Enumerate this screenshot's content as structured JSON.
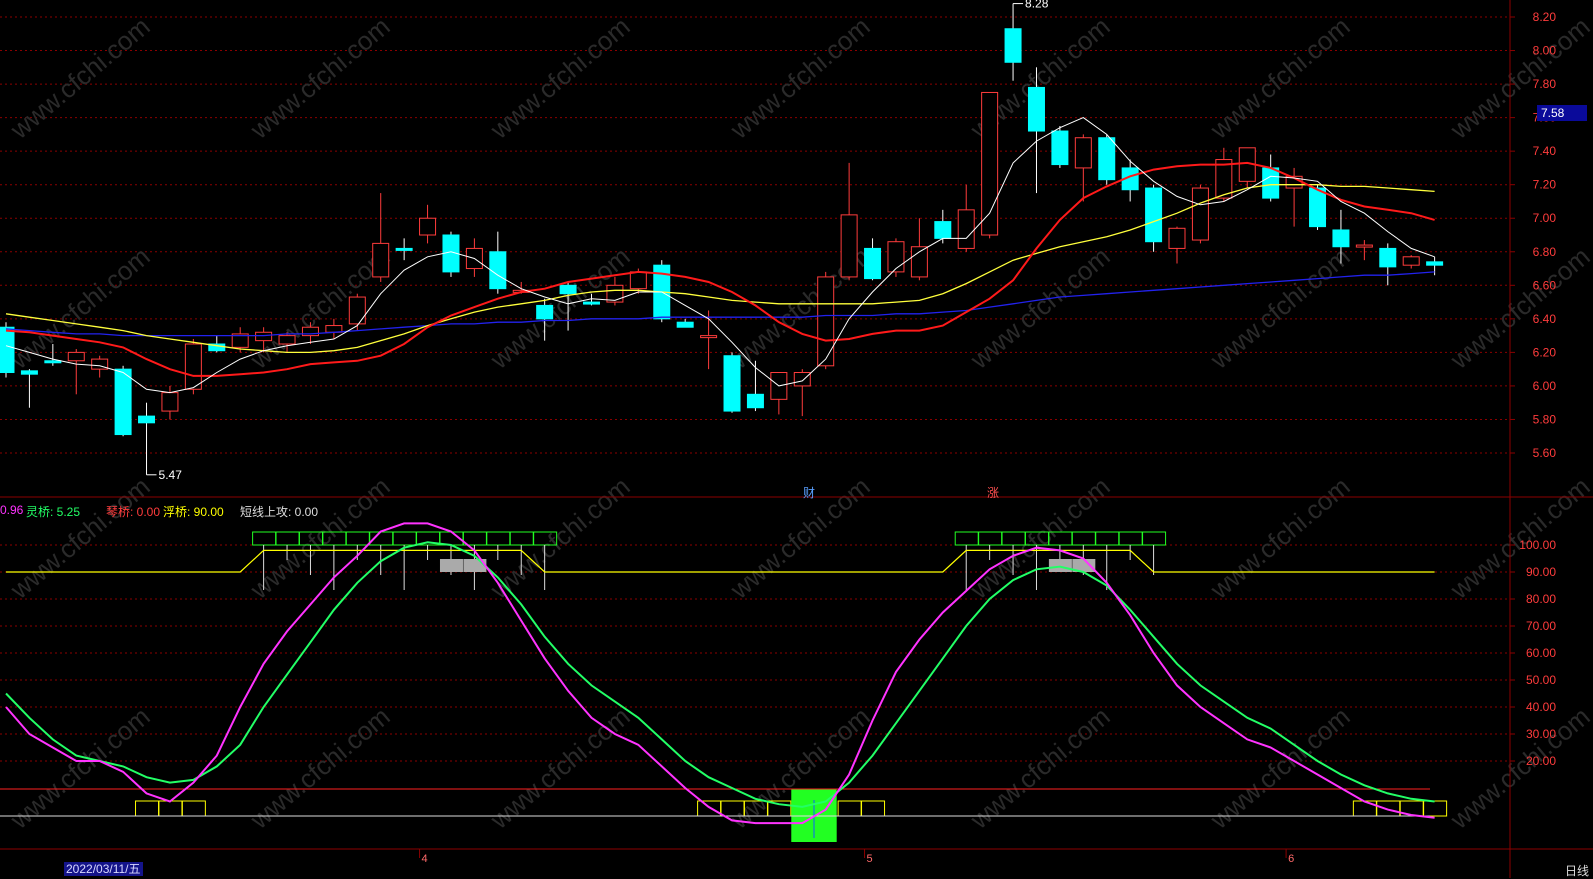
{
  "theme": {
    "up": "#ff3c3c",
    "down": "#00ffff",
    "grid": "#8b0000",
    "axis_text": "#ff3c3c",
    "ma5": "#ffffff",
    "ma10": "#ff1a1a",
    "ma20": "#ffff3c",
    "ma60": "#2222ee",
    "piano": "#ff33ff",
    "spirit": "#22ff66",
    "float": "#ffff00"
  },
  "header": {
    "indicator_labels": [
      {
        "text": "0.96",
        "color": "#ff33ff"
      },
      {
        "text": "灵桥: 5.25",
        "color": "#22ff66"
      },
      {
        "text": "琴桥: 0.00",
        "color": "#ff3c3c"
      },
      {
        "text": "浮桥: 90.00",
        "color": "#ffff00"
      },
      {
        "text": "短线上攻: 0.00",
        "color": "#dddddd"
      }
    ]
  },
  "footer": {
    "date_label": "2022/03/11/五",
    "period_label": "日线",
    "month_labels": [
      "4",
      "5",
      "6"
    ]
  },
  "price_marker": {
    "value": "7.58"
  },
  "events": [
    {
      "text": "财",
      "color": "#5aa0ff"
    },
    {
      "text": "涨",
      "color": "#ff5050"
    }
  ],
  "chart_data": [
    {
      "type": "candlestick",
      "ylim": [
        5.4,
        8.3
      ],
      "y_ticks": [
        "5.60",
        "5.80",
        "6.00",
        "6.20",
        "6.40",
        "6.60",
        "6.80",
        "7.00",
        "7.20",
        "7.40",
        "7.60",
        "7.80",
        "8.00",
        "8.20"
      ],
      "annotations": [
        {
          "text": "8.28"
        },
        {
          "text": "5.47"
        }
      ],
      "candles": [
        {
          "o": 6.35,
          "h": 6.38,
          "l": 6.05,
          "c": 6.08
        },
        {
          "o": 6.09,
          "h": 6.1,
          "l": 5.87,
          "c": 6.07
        },
        {
          "o": 6.15,
          "h": 6.25,
          "l": 6.12,
          "c": 6.14
        },
        {
          "o": 6.15,
          "h": 6.22,
          "l": 5.95,
          "c": 6.2
        },
        {
          "o": 6.1,
          "h": 6.18,
          "l": 6.05,
          "c": 6.16
        },
        {
          "o": 6.1,
          "h": 6.12,
          "l": 5.7,
          "c": 5.71
        },
        {
          "o": 5.82,
          "h": 5.9,
          "l": 5.47,
          "c": 5.78
        },
        {
          "o": 5.85,
          "h": 6.0,
          "l": 5.8,
          "c": 5.96
        },
        {
          "o": 5.98,
          "h": 6.28,
          "l": 5.95,
          "c": 6.25
        },
        {
          "o": 6.25,
          "h": 6.3,
          "l": 6.2,
          "c": 6.21
        },
        {
          "o": 6.23,
          "h": 6.35,
          "l": 6.2,
          "c": 6.31
        },
        {
          "o": 6.27,
          "h": 6.35,
          "l": 6.2,
          "c": 6.32
        },
        {
          "o": 6.25,
          "h": 6.32,
          "l": 6.2,
          "c": 6.3
        },
        {
          "o": 6.3,
          "h": 6.38,
          "l": 6.25,
          "c": 6.35
        },
        {
          "o": 6.32,
          "h": 6.4,
          "l": 6.28,
          "c": 6.36
        },
        {
          "o": 6.37,
          "h": 6.55,
          "l": 6.33,
          "c": 6.53
        },
        {
          "o": 6.65,
          "h": 7.15,
          "l": 6.62,
          "c": 6.85
        },
        {
          "o": 6.82,
          "h": 6.88,
          "l": 6.75,
          "c": 6.81
        },
        {
          "o": 6.9,
          "h": 7.08,
          "l": 6.85,
          "c": 7.0
        },
        {
          "o": 6.9,
          "h": 6.92,
          "l": 6.65,
          "c": 6.68
        },
        {
          "o": 6.7,
          "h": 6.88,
          "l": 6.65,
          "c": 6.82
        },
        {
          "o": 6.8,
          "h": 6.92,
          "l": 6.55,
          "c": 6.58
        },
        {
          "o": 6.57,
          "h": 6.62,
          "l": 6.55,
          "c": 6.57
        },
        {
          "o": 6.48,
          "h": 6.52,
          "l": 6.27,
          "c": 6.4
        },
        {
          "o": 6.6,
          "h": 6.62,
          "l": 6.33,
          "c": 6.55
        },
        {
          "o": 6.5,
          "h": 6.55,
          "l": 6.48,
          "c": 6.49
        },
        {
          "o": 6.5,
          "h": 6.65,
          "l": 6.48,
          "c": 6.6
        },
        {
          "o": 6.58,
          "h": 6.7,
          "l": 6.55,
          "c": 6.68
        },
        {
          "o": 6.72,
          "h": 6.75,
          "l": 6.38,
          "c": 6.4
        },
        {
          "o": 6.38,
          "h": 6.4,
          "l": 6.35,
          "c": 6.35
        },
        {
          "o": 6.3,
          "h": 6.45,
          "l": 6.1,
          "c": 6.3
        },
        {
          "o": 6.18,
          "h": 6.2,
          "l": 5.84,
          "c": 5.85
        },
        {
          "o": 5.95,
          "h": 6.15,
          "l": 5.85,
          "c": 5.87
        },
        {
          "o": 5.92,
          "h": 6.05,
          "l": 5.83,
          "c": 6.08
        },
        {
          "o": 6.0,
          "h": 6.1,
          "l": 5.82,
          "c": 6.08
        },
        {
          "o": 6.12,
          "h": 6.68,
          "l": 6.1,
          "c": 6.65
        },
        {
          "o": 6.65,
          "h": 7.33,
          "l": 6.63,
          "c": 7.02
        },
        {
          "o": 6.82,
          "h": 6.88,
          "l": 6.63,
          "c": 6.64
        },
        {
          "o": 6.68,
          "h": 6.88,
          "l": 6.65,
          "c": 6.86
        },
        {
          "o": 6.65,
          "h": 7.0,
          "l": 6.63,
          "c": 6.83
        },
        {
          "o": 6.98,
          "h": 7.05,
          "l": 6.85,
          "c": 6.88
        },
        {
          "o": 6.82,
          "h": 7.2,
          "l": 6.8,
          "c": 7.05
        },
        {
          "o": 6.9,
          "h": 7.45,
          "l": 6.88,
          "c": 7.75
        },
        {
          "o": 8.13,
          "h": 8.28,
          "l": 7.82,
          "c": 7.93
        },
        {
          "o": 7.78,
          "h": 7.9,
          "l": 7.15,
          "c": 7.52
        },
        {
          "o": 7.52,
          "h": 7.55,
          "l": 7.3,
          "c": 7.32
        },
        {
          "o": 7.3,
          "h": 7.5,
          "l": 7.1,
          "c": 7.48
        },
        {
          "o": 7.48,
          "h": 7.5,
          "l": 7.2,
          "c": 7.23
        },
        {
          "o": 7.3,
          "h": 7.35,
          "l": 7.1,
          "c": 7.17
        },
        {
          "o": 7.18,
          "h": 7.2,
          "l": 6.8,
          "c": 6.86
        },
        {
          "o": 6.82,
          "h": 6.95,
          "l": 6.73,
          "c": 6.94
        },
        {
          "o": 6.87,
          "h": 7.2,
          "l": 6.85,
          "c": 7.18
        },
        {
          "o": 7.12,
          "h": 7.42,
          "l": 7.1,
          "c": 7.35
        },
        {
          "o": 7.22,
          "h": 7.42,
          "l": 7.18,
          "c": 7.42
        },
        {
          "o": 7.3,
          "h": 7.38,
          "l": 7.1,
          "c": 7.12
        },
        {
          "o": 7.18,
          "h": 7.3,
          "l": 6.95,
          "c": 7.25
        },
        {
          "o": 7.18,
          "h": 7.2,
          "l": 6.93,
          "c": 6.95
        },
        {
          "o": 6.93,
          "h": 7.05,
          "l": 6.73,
          "c": 6.83
        },
        {
          "o": 6.83,
          "h": 6.87,
          "l": 6.75,
          "c": 6.84
        },
        {
          "o": 6.82,
          "h": 6.85,
          "l": 6.6,
          "c": 6.71
        },
        {
          "o": 6.72,
          "h": 6.78,
          "l": 6.7,
          "c": 6.77
        },
        {
          "o": 6.74,
          "h": 6.77,
          "l": 6.66,
          "c": 6.72
        }
      ],
      "ma5": [
        6.24,
        6.2,
        6.16,
        6.13,
        6.12,
        6.08,
        5.98,
        5.96,
        5.99,
        6.08,
        6.16,
        6.21,
        6.24,
        6.26,
        6.28,
        6.36,
        6.55,
        6.69,
        6.77,
        6.8,
        6.76,
        6.66,
        6.58,
        6.53,
        6.49,
        6.52,
        6.51,
        6.56,
        6.56,
        6.48,
        6.4,
        6.26,
        6.11,
        6.0,
        6.03,
        6.16,
        6.4,
        6.56,
        6.7,
        6.8,
        6.88,
        6.88,
        7.03,
        7.33,
        7.46,
        7.54,
        7.6,
        7.5,
        7.34,
        7.22,
        7.13,
        7.08,
        7.1,
        7.17,
        7.25,
        7.24,
        7.22,
        7.1,
        7.03,
        6.92,
        6.82,
        6.77
      ],
      "ma10": [
        6.33,
        6.32,
        6.3,
        6.28,
        6.26,
        6.23,
        6.16,
        6.1,
        6.06,
        6.06,
        6.07,
        6.08,
        6.1,
        6.13,
        6.14,
        6.15,
        6.18,
        6.25,
        6.35,
        6.42,
        6.47,
        6.52,
        6.56,
        6.58,
        6.62,
        6.64,
        6.66,
        6.68,
        6.67,
        6.65,
        6.62,
        6.56,
        6.48,
        6.38,
        6.31,
        6.27,
        6.28,
        6.31,
        6.33,
        6.33,
        6.36,
        6.44,
        6.52,
        6.63,
        6.82,
        6.99,
        7.12,
        7.19,
        7.25,
        7.29,
        7.31,
        7.32,
        7.32,
        7.33,
        7.3,
        7.24,
        7.17,
        7.11,
        7.07,
        7.05,
        7.03,
        6.99
      ],
      "ma20": [
        6.43,
        6.41,
        6.39,
        6.37,
        6.35,
        6.33,
        6.3,
        6.28,
        6.26,
        6.24,
        6.22,
        6.21,
        6.2,
        6.2,
        6.21,
        6.23,
        6.27,
        6.31,
        6.36,
        6.4,
        6.44,
        6.47,
        6.49,
        6.51,
        6.54,
        6.56,
        6.57,
        6.57,
        6.56,
        6.55,
        6.53,
        6.51,
        6.5,
        6.49,
        6.49,
        6.49,
        6.49,
        6.49,
        6.5,
        6.51,
        6.55,
        6.61,
        6.68,
        6.75,
        6.79,
        6.83,
        6.86,
        6.89,
        6.93,
        6.98,
        7.03,
        7.09,
        7.14,
        7.18,
        7.2,
        7.2,
        7.2,
        7.19,
        7.19,
        7.18,
        7.17,
        7.16
      ],
      "ma60": [
        6.34,
        6.33,
        6.32,
        6.31,
        6.31,
        6.3,
        6.3,
        6.3,
        6.3,
        6.3,
        6.3,
        6.3,
        6.31,
        6.31,
        6.32,
        6.33,
        6.34,
        6.35,
        6.36,
        6.37,
        6.37,
        6.38,
        6.38,
        6.39,
        6.39,
        6.4,
        6.4,
        6.4,
        6.41,
        6.41,
        6.41,
        6.41,
        6.41,
        6.41,
        6.41,
        6.42,
        6.42,
        6.42,
        6.43,
        6.43,
        6.44,
        6.45,
        6.47,
        6.49,
        6.51,
        6.53,
        6.54,
        6.55,
        6.56,
        6.57,
        6.58,
        6.59,
        6.6,
        6.61,
        6.62,
        6.63,
        6.64,
        6.65,
        6.66,
        6.66,
        6.67,
        6.68
      ]
    },
    {
      "type": "line",
      "ylim": [
        -5,
        112
      ],
      "y_ticks": [
        "20.00",
        "30.00",
        "40.00",
        "50.00",
        "60.00",
        "70.00",
        "80.00",
        "90.00",
        "100.00"
      ],
      "series": [
        {
          "name": "琴桥",
          "values": [
            40,
            30,
            25,
            20,
            20,
            16,
            8,
            5,
            12,
            22,
            40,
            56,
            68,
            78,
            88,
            96,
            105,
            108,
            108,
            105,
            98,
            86,
            72,
            58,
            46,
            36,
            30,
            26,
            18,
            10,
            3,
            -2,
            -3,
            -3,
            -3,
            2,
            15,
            35,
            53,
            65,
            75,
            83,
            91,
            96,
            99,
            98,
            95,
            86,
            74,
            60,
            48,
            40,
            34,
            28,
            25,
            20,
            15,
            10,
            5,
            2,
            0,
            -1
          ]
        },
        {
          "name": "灵桥",
          "values": [
            45,
            36,
            28,
            22,
            20,
            18,
            14,
            12,
            13,
            18,
            26,
            40,
            52,
            64,
            76,
            86,
            94,
            99,
            101,
            100,
            96,
            88,
            78,
            66,
            56,
            48,
            42,
            36,
            28,
            20,
            14,
            10,
            6,
            4,
            3,
            5,
            12,
            22,
            34,
            46,
            58,
            70,
            80,
            87,
            91,
            92,
            90,
            85,
            76,
            66,
            56,
            48,
            42,
            36,
            32,
            26,
            20,
            15,
            11,
            8,
            6,
            5
          ]
        },
        {
          "name": "浮桥",
          "values": [
            90,
            90,
            90,
            90,
            90,
            90,
            90,
            90,
            90,
            90,
            90,
            98,
            98,
            98,
            98,
            98,
            98,
            98,
            98,
            98,
            98,
            98,
            98,
            90,
            90,
            90,
            90,
            90,
            90,
            90,
            90,
            90,
            90,
            90,
            90,
            90,
            90,
            90,
            90,
            90,
            90,
            98,
            98,
            98,
            98,
            98,
            98,
            98,
            98,
            90,
            90,
            90,
            90,
            90,
            90,
            90,
            90,
            90,
            90,
            90,
            90,
            90
          ]
        }
      ],
      "bars_top": [
        11,
        12,
        13,
        14,
        15,
        16,
        17,
        18,
        19,
        20,
        21,
        22,
        23,
        41,
        42,
        43,
        44,
        45,
        46,
        47,
        48,
        49
      ],
      "bars_gray": [
        19,
        20,
        45,
        46
      ],
      "bars_bottom": [
        6,
        7,
        8,
        30,
        31,
        32,
        33,
        36,
        37,
        58,
        59,
        60,
        61
      ],
      "signal_green": [
        34,
        35
      ]
    }
  ]
}
